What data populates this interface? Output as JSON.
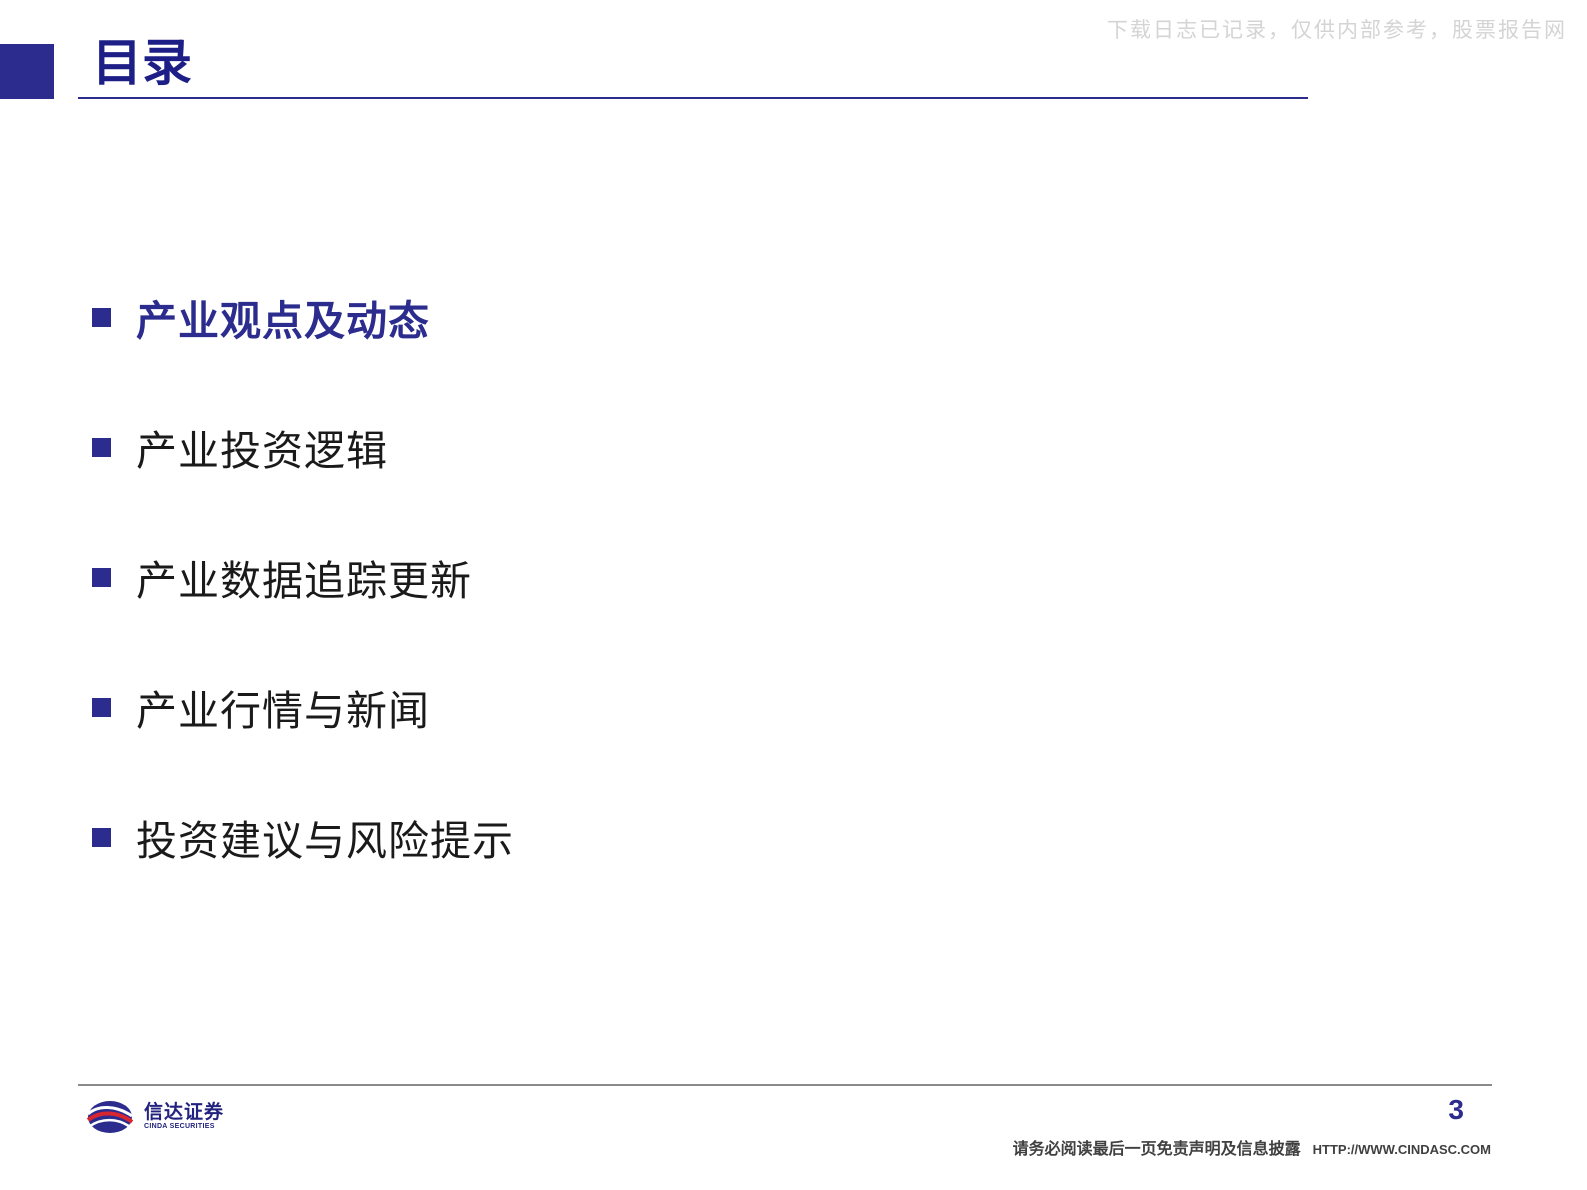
{
  "watermark": "下载日志已记录，仅供内部参考，股票报告网",
  "header": {
    "title": "目录"
  },
  "toc": {
    "items": [
      {
        "label": "产业观点及动态",
        "active": true
      },
      {
        "label": "产业投资逻辑",
        "active": false
      },
      {
        "label": "产业数据追踪更新",
        "active": false
      },
      {
        "label": "产业行情与新闻",
        "active": false
      },
      {
        "label": "投资建议与风险提示",
        "active": false
      }
    ]
  },
  "footer": {
    "logo_cn": "信达证券",
    "logo_en": "CINDA SECURITIES",
    "page_number": "3",
    "disclaimer": "请务必阅读最后一页免责声明及信息披露",
    "url": "HTTP://WWW.CINDASC.COM"
  },
  "colors": {
    "brand": "#2b2c8e",
    "logo_red": "#d7262f"
  }
}
